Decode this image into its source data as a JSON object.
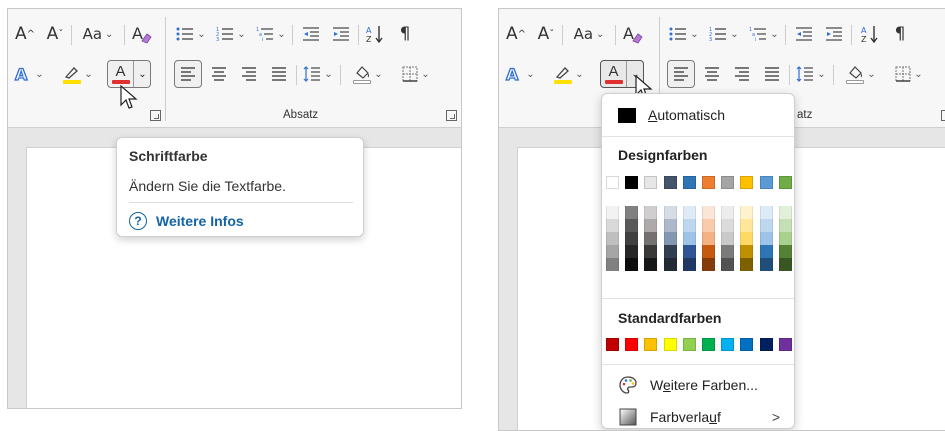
{
  "left_panel": {
    "ribbon": {
      "font_row1": {
        "grow_label": "A",
        "shrink_label": "A",
        "case_label": "Aa",
        "clear_format_icon": "clear-formatting-icon"
      },
      "paragraph_group_label": "Absatz"
    },
    "tooltip": {
      "title": "Schriftfarbe",
      "description": "Ändern Sie die Textfarbe.",
      "link_label": "Weitere Infos",
      "link_icon": "?"
    }
  },
  "right_panel": {
    "ribbon": {
      "font_row1": {
        "grow_label": "A",
        "shrink_label": "A",
        "case_label": "Aa"
      },
      "paragraph_group_label_visible": "atz"
    },
    "dropdown": {
      "automatic_label": "Automatisch",
      "automatic_underline_char": "A",
      "automatic_rest": "utomatisch",
      "design_colors_heading": "Designfarben",
      "standard_colors_heading": "Standardfarben",
      "more_colors_prefix": "W",
      "more_colors_underline_char": "e",
      "more_colors_rest": "itere Farben...",
      "gradient_prefix": "Farbverla",
      "gradient_underline_char": "u",
      "gradient_rest": "f",
      "submenu_arrow": ">"
    },
    "design_colors_top": [
      "#ffffff",
      "#000000",
      "#e7e6e6",
      "#44546a",
      "#2e75b6",
      "#ed7d31",
      "#a5a5a5",
      "#ffc000",
      "#5b9bd5",
      "#70ad47"
    ],
    "design_shades": [
      [
        "#f2f2f2",
        "#d9d9d9",
        "#bfbfbf",
        "#a6a6a6",
        "#808080"
      ],
      [
        "#808080",
        "#595959",
        "#404040",
        "#262626",
        "#0d0d0d"
      ],
      [
        "#d0cece",
        "#aeaaaa",
        "#767171",
        "#3b3838",
        "#181717"
      ],
      [
        "#d6dce4",
        "#adb9ca",
        "#8497b0",
        "#333f50",
        "#222a35"
      ],
      [
        "#deebf7",
        "#bdd7ee",
        "#9dc3e6",
        "#2f5597",
        "#1f3864"
      ],
      [
        "#fbe5d6",
        "#f8cbad",
        "#f4b183",
        "#c55a11",
        "#843c0c"
      ],
      [
        "#ededed",
        "#dbdbdb",
        "#c9c9c9",
        "#7b7b7b",
        "#525252"
      ],
      [
        "#fff2cc",
        "#ffe699",
        "#ffd966",
        "#bf9000",
        "#7f6000"
      ],
      [
        "#ddebf7",
        "#bdd7ee",
        "#9dc3e6",
        "#2e75b6",
        "#1f4e79"
      ],
      [
        "#e2f0d9",
        "#c5e0b4",
        "#a9d18e",
        "#548235",
        "#385723"
      ]
    ],
    "standard_colors": [
      "#c00000",
      "#ff0000",
      "#ffc000",
      "#ffff00",
      "#92d050",
      "#00b050",
      "#00b0f0",
      "#0070c0",
      "#002060",
      "#7030a0"
    ]
  },
  "colors": {
    "font_color_bar": "#e03030",
    "highlight_bar": "#ffe000",
    "text_effect_blue": "#2f6fd6",
    "link_blue": "#1464a5"
  }
}
